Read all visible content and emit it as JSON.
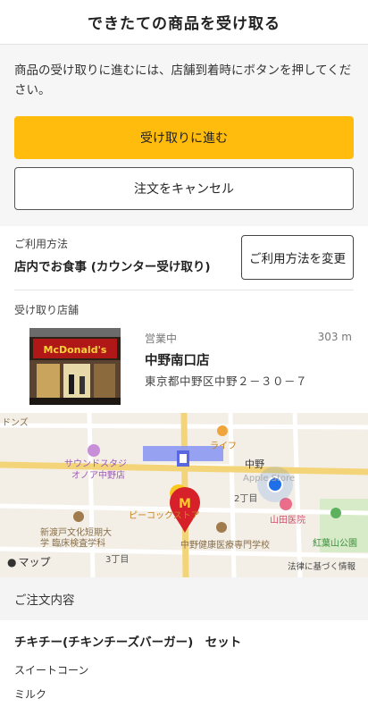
{
  "header": {
    "title": "できたての商品を受け取る"
  },
  "instructions": "商品の受け取りに進むには、店舗到着時にボタンを押してください。",
  "buttons": {
    "proceed": "受け取りに進む",
    "cancel": "注文をキャンセル"
  },
  "usage": {
    "label": "ご利用方法",
    "value": "店内でお食事 (カウンター受け取り)",
    "change_button": "ご利用方法を変更"
  },
  "store": {
    "section_label": "受け取り店舗",
    "photo_sign": "McDonald's",
    "status": "営業中",
    "distance": "303 m",
    "name": "中野南口店",
    "address": "東京都中野区中野２－３０－７"
  },
  "map": {
    "labels": {
      "top_left": "ドンズ",
      "sound_studio": "サウンドスタジ",
      "sound_studio2": "オノア中野店",
      "life": "ライフ",
      "nakano": "中野",
      "apple_store": "Apple Store",
      "nichome": "2丁目",
      "yamada": "山田医院",
      "peacock": "ピーコックストア",
      "shintoko_1": "新渡戸文化短期大",
      "shintoko_2": "学 臨床検査学科",
      "koyosan": "紅葉山公園",
      "kenkou": "中野健康医療専門学校",
      "sanchome": "3丁目",
      "apple_maps": "マップ",
      "legal": "法律に基づく情報"
    },
    "colors": {
      "rail": "#7f8cf0",
      "route": "#f3d276",
      "pin": "#d6202a",
      "user": "#1f6fe8",
      "park": "#cfe6c0"
    }
  },
  "order": {
    "header": "ご注文内容",
    "item_title": "チキチー(チキンチーズバーガー)　セット",
    "side": "スイートコーン",
    "drink": "ミルク"
  }
}
